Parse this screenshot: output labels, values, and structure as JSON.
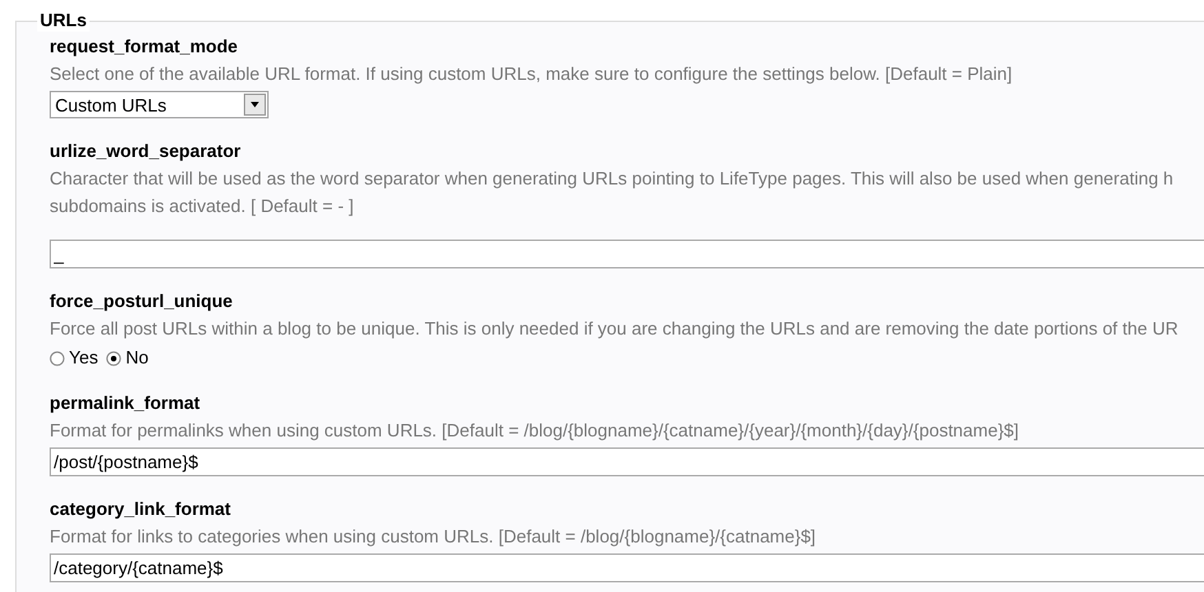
{
  "fieldset": {
    "legend": "URLs"
  },
  "settings": [
    {
      "kind": "select",
      "name": "request_format_mode",
      "description": "Select one of the available URL format. If using custom URLs, make sure to configure the settings below. [Default = Plain]",
      "value": "Custom URLs"
    },
    {
      "kind": "text",
      "name": "urlize_word_separator",
      "description": "Character that will be used as the word separator when generating URLs pointing to LifeType pages. This will also be used when generating h subdomains is activated. [ Default = - ]",
      "value": "_"
    },
    {
      "kind": "radio",
      "name": "force_posturl_unique",
      "description": "Force all post URLs within a blog to be unique. This is only needed if you are changing the URLs and are removing the date portions of the UR",
      "options": [
        {
          "label": "Yes",
          "selected": false
        },
        {
          "label": "No",
          "selected": true
        }
      ]
    },
    {
      "kind": "text",
      "name": "permalink_format",
      "description": "Format for permalinks when using custom URLs. [Default = /blog/{blogname}/{catname}/{year}/{month}/{day}/{postname}$]",
      "value": "/post/{postname}$"
    },
    {
      "kind": "text",
      "name": "category_link_format",
      "description": "Format for links to categories when using custom URLs. [Default = /blog/{blogname}/{catname}$]",
      "value": "/category/{catname}$"
    }
  ]
}
